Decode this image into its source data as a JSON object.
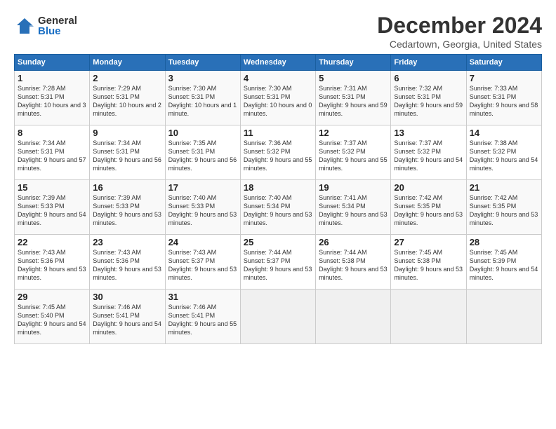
{
  "app": {
    "logo_general": "General",
    "logo_blue": "Blue"
  },
  "header": {
    "month": "December 2024",
    "location": "Cedartown, Georgia, United States"
  },
  "weekdays": [
    "Sunday",
    "Monday",
    "Tuesday",
    "Wednesday",
    "Thursday",
    "Friday",
    "Saturday"
  ],
  "weeks": [
    [
      {
        "day": "1",
        "sunrise": "7:28 AM",
        "sunset": "5:31 PM",
        "daylight": "10 hours and 3 minutes."
      },
      {
        "day": "2",
        "sunrise": "7:29 AM",
        "sunset": "5:31 PM",
        "daylight": "10 hours and 2 minutes."
      },
      {
        "day": "3",
        "sunrise": "7:30 AM",
        "sunset": "5:31 PM",
        "daylight": "10 hours and 1 minute."
      },
      {
        "day": "4",
        "sunrise": "7:30 AM",
        "sunset": "5:31 PM",
        "daylight": "10 hours and 0 minutes."
      },
      {
        "day": "5",
        "sunrise": "7:31 AM",
        "sunset": "5:31 PM",
        "daylight": "9 hours and 59 minutes."
      },
      {
        "day": "6",
        "sunrise": "7:32 AM",
        "sunset": "5:31 PM",
        "daylight": "9 hours and 59 minutes."
      },
      {
        "day": "7",
        "sunrise": "7:33 AM",
        "sunset": "5:31 PM",
        "daylight": "9 hours and 58 minutes."
      }
    ],
    [
      {
        "day": "8",
        "sunrise": "7:34 AM",
        "sunset": "5:31 PM",
        "daylight": "9 hours and 57 minutes."
      },
      {
        "day": "9",
        "sunrise": "7:34 AM",
        "sunset": "5:31 PM",
        "daylight": "9 hours and 56 minutes."
      },
      {
        "day": "10",
        "sunrise": "7:35 AM",
        "sunset": "5:31 PM",
        "daylight": "9 hours and 56 minutes."
      },
      {
        "day": "11",
        "sunrise": "7:36 AM",
        "sunset": "5:32 PM",
        "daylight": "9 hours and 55 minutes."
      },
      {
        "day": "12",
        "sunrise": "7:37 AM",
        "sunset": "5:32 PM",
        "daylight": "9 hours and 55 minutes."
      },
      {
        "day": "13",
        "sunrise": "7:37 AM",
        "sunset": "5:32 PM",
        "daylight": "9 hours and 54 minutes."
      },
      {
        "day": "14",
        "sunrise": "7:38 AM",
        "sunset": "5:32 PM",
        "daylight": "9 hours and 54 minutes."
      }
    ],
    [
      {
        "day": "15",
        "sunrise": "7:39 AM",
        "sunset": "5:33 PM",
        "daylight": "9 hours and 54 minutes."
      },
      {
        "day": "16",
        "sunrise": "7:39 AM",
        "sunset": "5:33 PM",
        "daylight": "9 hours and 53 minutes."
      },
      {
        "day": "17",
        "sunrise": "7:40 AM",
        "sunset": "5:33 PM",
        "daylight": "9 hours and 53 minutes."
      },
      {
        "day": "18",
        "sunrise": "7:40 AM",
        "sunset": "5:34 PM",
        "daylight": "9 hours and 53 minutes."
      },
      {
        "day": "19",
        "sunrise": "7:41 AM",
        "sunset": "5:34 PM",
        "daylight": "9 hours and 53 minutes."
      },
      {
        "day": "20",
        "sunrise": "7:42 AM",
        "sunset": "5:35 PM",
        "daylight": "9 hours and 53 minutes."
      },
      {
        "day": "21",
        "sunrise": "7:42 AM",
        "sunset": "5:35 PM",
        "daylight": "9 hours and 53 minutes."
      }
    ],
    [
      {
        "day": "22",
        "sunrise": "7:43 AM",
        "sunset": "5:36 PM",
        "daylight": "9 hours and 53 minutes."
      },
      {
        "day": "23",
        "sunrise": "7:43 AM",
        "sunset": "5:36 PM",
        "daylight": "9 hours and 53 minutes."
      },
      {
        "day": "24",
        "sunrise": "7:43 AM",
        "sunset": "5:37 PM",
        "daylight": "9 hours and 53 minutes."
      },
      {
        "day": "25",
        "sunrise": "7:44 AM",
        "sunset": "5:37 PM",
        "daylight": "9 hours and 53 minutes."
      },
      {
        "day": "26",
        "sunrise": "7:44 AM",
        "sunset": "5:38 PM",
        "daylight": "9 hours and 53 minutes."
      },
      {
        "day": "27",
        "sunrise": "7:45 AM",
        "sunset": "5:38 PM",
        "daylight": "9 hours and 53 minutes."
      },
      {
        "day": "28",
        "sunrise": "7:45 AM",
        "sunset": "5:39 PM",
        "daylight": "9 hours and 54 minutes."
      }
    ],
    [
      {
        "day": "29",
        "sunrise": "7:45 AM",
        "sunset": "5:40 PM",
        "daylight": "9 hours and 54 minutes."
      },
      {
        "day": "30",
        "sunrise": "7:46 AM",
        "sunset": "5:41 PM",
        "daylight": "9 hours and 54 minutes."
      },
      {
        "day": "31",
        "sunrise": "7:46 AM",
        "sunset": "5:41 PM",
        "daylight": "9 hours and 55 minutes."
      },
      null,
      null,
      null,
      null
    ]
  ],
  "labels": {
    "sunrise": "Sunrise:",
    "sunset": "Sunset:",
    "daylight": "Daylight:"
  }
}
